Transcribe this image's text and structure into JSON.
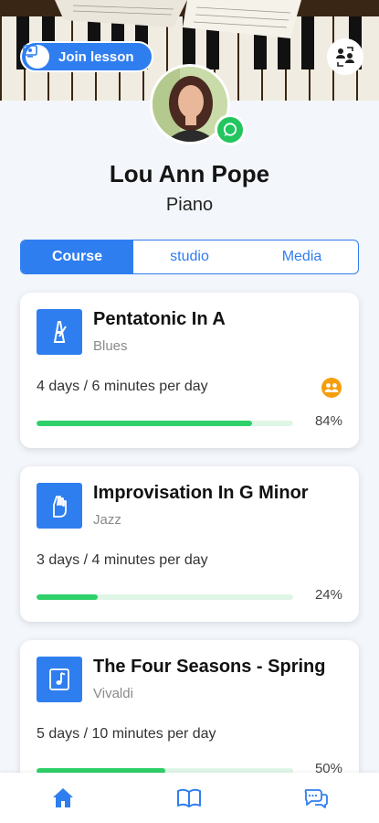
{
  "header": {
    "join_label": "Join lesson"
  },
  "profile": {
    "name": "Lou Ann Pope",
    "instrument": "Piano"
  },
  "tabs": [
    {
      "label": "Course",
      "active": true
    },
    {
      "label": "studio",
      "active": false
    },
    {
      "label": "Media",
      "active": false
    }
  ],
  "courses": [
    {
      "title": "Pentatonic In A",
      "subtitle": "Blues",
      "schedule": "4 days / 6 minutes per day",
      "progress": 0.84,
      "progress_label": "84%",
      "icon": "metronome-icon",
      "group_icon": true
    },
    {
      "title": "Improvisation In G Minor",
      "subtitle": "Jazz",
      "schedule": "3 days / 4 minutes per day",
      "progress": 0.24,
      "progress_label": "24%",
      "icon": "hand-gesture-icon",
      "group_icon": false
    },
    {
      "title": "The Four Seasons - Spring",
      "subtitle": "Vivaldi",
      "schedule": "5 days / 10 minutes per day",
      "progress": 0.5,
      "progress_label": "50%",
      "icon": "music-note-icon",
      "group_icon": false
    }
  ],
  "bottom_nav": [
    {
      "icon": "home-icon",
      "active": true
    },
    {
      "icon": "book-icon",
      "active": false
    },
    {
      "icon": "chat-bubbles-icon",
      "active": false
    }
  ],
  "colors": {
    "accent": "#2f7ef0",
    "progress": "#2fd06a",
    "progress_track": "#dff6e7",
    "online": "#22c55e",
    "group": "#f59e0b"
  }
}
